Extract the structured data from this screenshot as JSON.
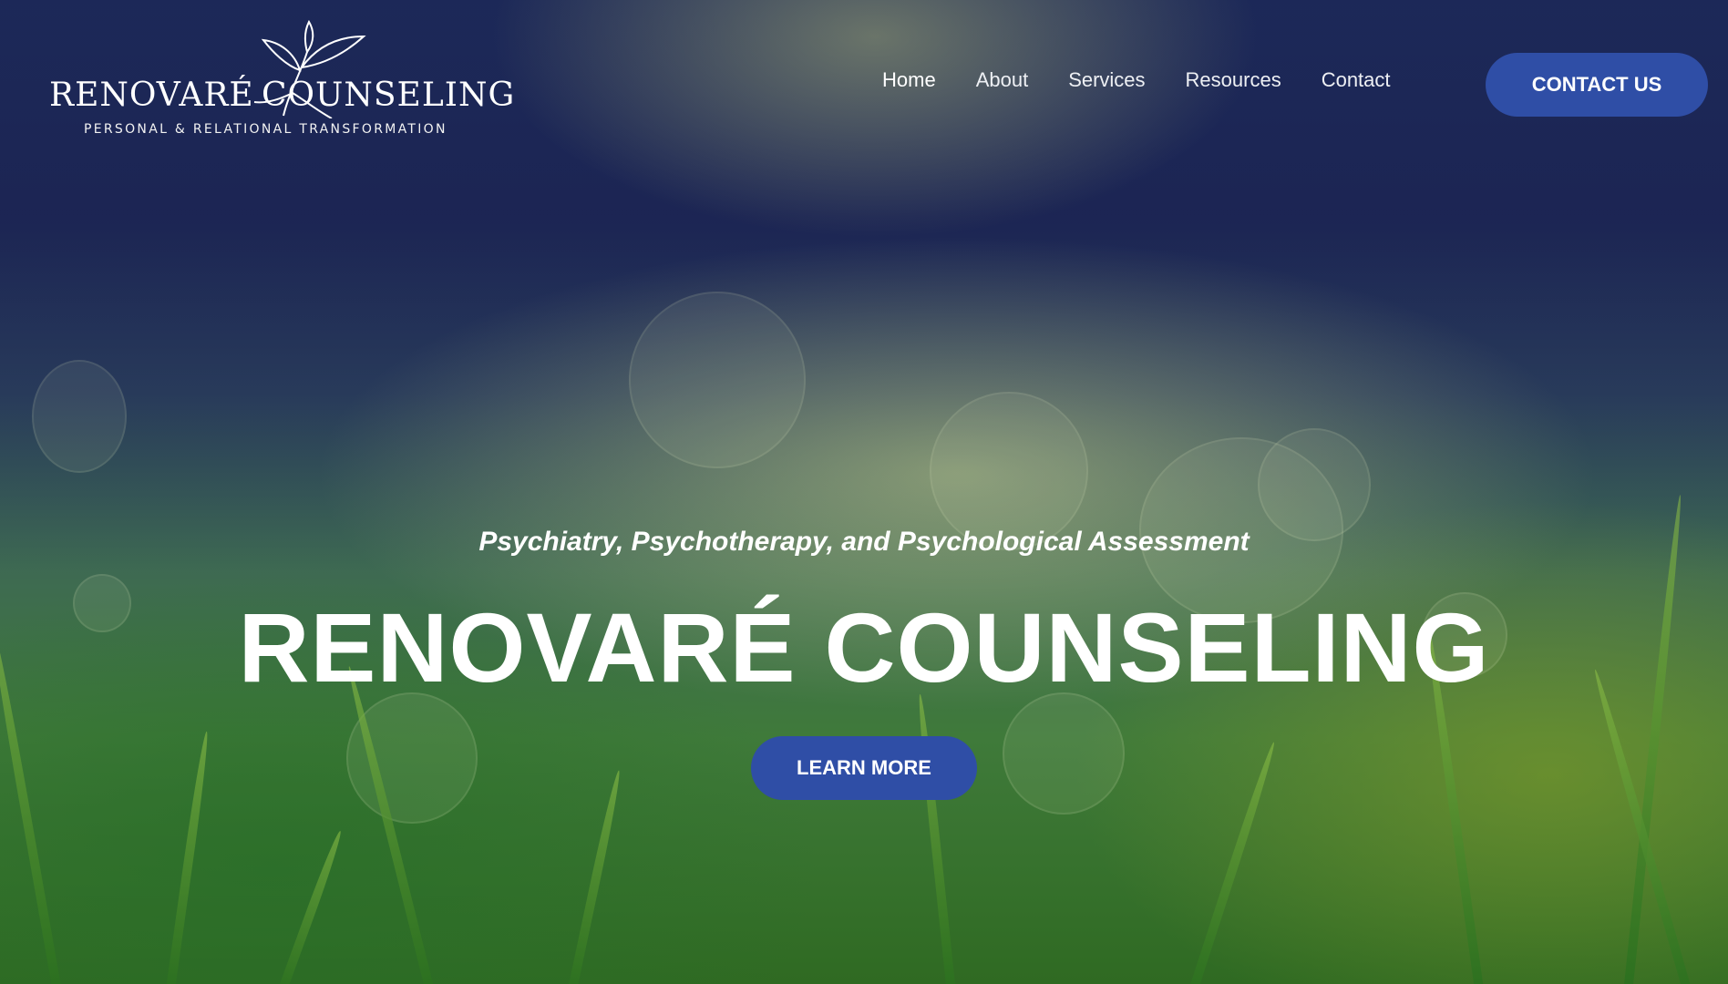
{
  "header": {
    "logo": {
      "name_left": "RENOVARÉ",
      "name_right": "COUNSELING",
      "tagline": "PERSONAL & RELATIONAL TRANSFORMATION",
      "icon": "leaf-sprig-icon"
    },
    "nav": [
      {
        "label": "Home",
        "active": true
      },
      {
        "label": "About"
      },
      {
        "label": "Services"
      },
      {
        "label": "Resources"
      },
      {
        "label": "Contact"
      }
    ],
    "cta_label": "CONTACT US"
  },
  "hero": {
    "subtitle": "Psychiatry, Psychotherapy, and Psychological Assessment",
    "title": "RENOVARÉ COUNSELING",
    "button_label": "LEARN MORE"
  },
  "colors": {
    "accent": "#2f4ea6",
    "text": "#ffffff"
  }
}
